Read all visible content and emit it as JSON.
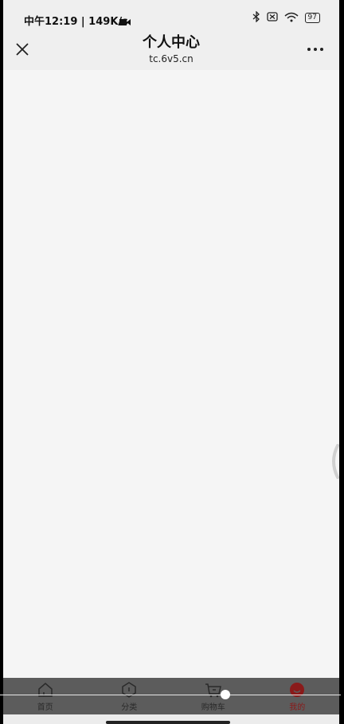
{
  "status_bar": {
    "time_speed": "中午12:19 | 149K/s",
    "battery": "97"
  },
  "nav": {
    "title": "个人中心",
    "url": "tc.6v5.cn"
  },
  "tabs": [
    {
      "label": "首页",
      "icon": "home-icon",
      "active": false
    },
    {
      "label": "分类",
      "icon": "category-icon",
      "active": false
    },
    {
      "label": "购物车",
      "icon": "cart-icon",
      "active": false
    },
    {
      "label": "我的",
      "icon": "profile-icon",
      "active": true
    }
  ],
  "colors": {
    "tab_active": "#8a1a1a",
    "tab_bar_bg": "#5c5c5c",
    "page_bg": "#f5f5f5"
  }
}
